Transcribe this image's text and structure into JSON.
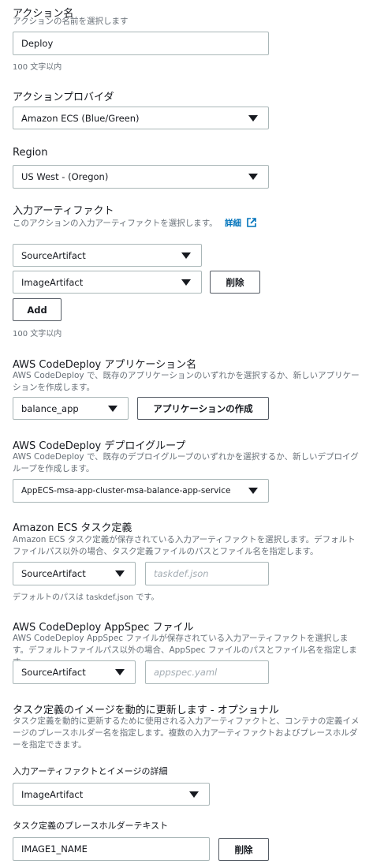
{
  "action_name": {
    "label": "アクション名",
    "description": "アクションの名前を選択します",
    "value": "Deploy",
    "hint": "100 文字以内"
  },
  "action_provider": {
    "label": "アクションプロバイダ",
    "value": "Amazon ECS (Blue/Green)"
  },
  "region": {
    "label": "Region",
    "value": "US West - (Oregon)"
  },
  "input_artifacts": {
    "label": "入力アーティファクト",
    "description": "このアクションの入力アーティファクトを選択します。",
    "details_link": "詳細",
    "items": [
      "SourceArtifact",
      "ImageArtifact"
    ],
    "remove_label": "削除",
    "add_label": "Add",
    "hint": "100 文字以内"
  },
  "codedeploy_app": {
    "label": "AWS CodeDeploy アプリケーション名",
    "description": "AWS CodeDeploy で、既存のアプリケーションのいずれかを選択するか、新しいアプリケーションを作成します。",
    "value": "balance_app",
    "create_label": "アプリケーションの作成"
  },
  "deploy_group": {
    "label": "AWS CodeDeploy デプロイグループ",
    "description": "AWS CodeDeploy で、既存のデプロイグループのいずれかを選択するか、新しいデプロイグループを作成します。",
    "value": "AppECS-msa-app-cluster-msa-balance-app-service"
  },
  "task_def": {
    "label": "Amazon ECS タスク定義",
    "description": "Amazon ECS タスク定義が保存されている入力アーティファクトを選択します。デフォルトファイルパス以外の場合、タスク定義ファイルのパスとファイル名を指定します。",
    "artifact": "SourceArtifact",
    "placeholder": "taskdef.json",
    "hint": "デフォルトのパスは taskdef.json です。"
  },
  "appspec": {
    "label": "AWS CodeDeploy AppSpec ファイル",
    "description": "AWS CodeDeploy AppSpec ファイルが保存されている入力アーティファクトを選択します。デフォルトファイルパス以外の場合、AppSpec ファイルのパスとファイル名を指定します。",
    "artifact": "SourceArtifact",
    "placeholder": "appspec.yaml"
  },
  "dynamic_update": {
    "label": "タスク定義のイメージを動的に更新します - オプショナル",
    "description": "タスク定義を動的に更新するために使用される入力アーティファクトと、コンテナの定義イメージのプレースホルダー名を指定します。複数の入力アーティファクトおよびプレースホルダーを指定できます。",
    "artifact_label": "入力アーティファクトとイメージの詳細",
    "artifact_value": "ImageArtifact",
    "placeholder_label": "タスク定義のプレースホルダーテキスト",
    "placeholder_value": "IMAGE1_NAME",
    "remove_label": "削除"
  },
  "icons": {
    "select": "caret-down-icon",
    "external": "external-link-icon"
  }
}
